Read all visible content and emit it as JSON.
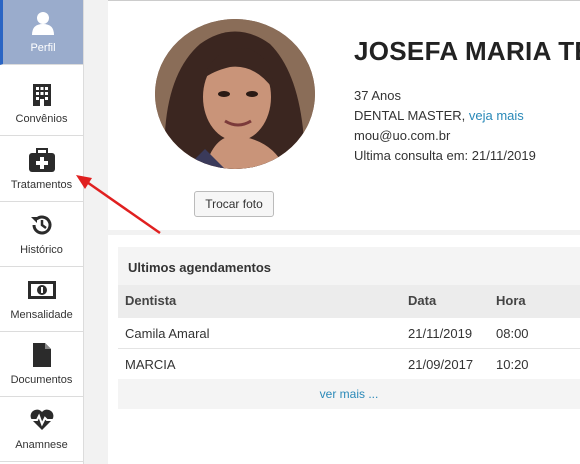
{
  "sidebar": {
    "items": [
      {
        "label": "Perfil",
        "icon": "user-icon",
        "active": true
      },
      {
        "label": "Convênios",
        "icon": "building-icon"
      },
      {
        "label": "Tratamentos",
        "icon": "medical-kit-icon"
      },
      {
        "label": "Histórico",
        "icon": "history-icon"
      },
      {
        "label": "Mensalidade",
        "icon": "money-icon"
      },
      {
        "label": "Documentos",
        "icon": "document-icon"
      },
      {
        "label": "Anamnese",
        "icon": "heartbeat-icon"
      }
    ]
  },
  "profile": {
    "name": "JOSEFA MARIA TEXEIRA",
    "age": "37 Anos",
    "plan": "DENTAL MASTER,",
    "plan_link": "veja mais",
    "email": "mou@uo.com.br",
    "last_visit": "Ultima consulta em: 21/11/2019",
    "photo_button": "Trocar foto"
  },
  "appointments": {
    "title": "Ultimos agendamentos",
    "headers": {
      "dentist": "Dentista",
      "date": "Data",
      "time": "Hora"
    },
    "rows": [
      {
        "dentist": "Camila Amaral",
        "date": "21/11/2019",
        "time": "08:00"
      },
      {
        "dentist": "MARCIA",
        "date": "21/09/2017",
        "time": "10:20"
      }
    ],
    "more_link": "ver mais ..."
  },
  "colors": {
    "active_bg": "#9aaccc",
    "active_border": "#2a65c4",
    "link": "#2a89b8",
    "arrow": "#e02020"
  }
}
